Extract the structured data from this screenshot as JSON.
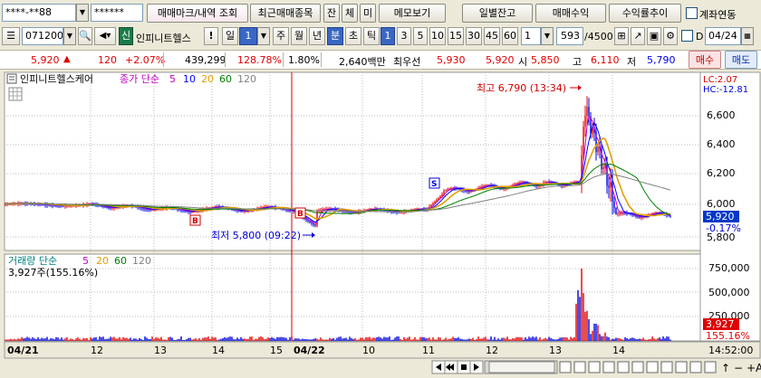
{
  "toolbar1": {
    "account": "****-**88",
    "password": "******",
    "mark_label": "매매마크/내역 조회",
    "recent_label": "최근매매종목",
    "jan": "잔",
    "che": "체",
    "mi": "미",
    "memo": "메모보기",
    "daily_balance": "일별잔고",
    "trade_profit": "매매수익",
    "yield_trend": "수익률추이",
    "account_link": "계좌연동"
  },
  "toolbar2": {
    "code": "071200",
    "sin": "신",
    "stock_name": "인피니트헬스",
    "alert": "!",
    "il": "일",
    "period_select": "1",
    "ju": "주",
    "wol": "월",
    "nyeon": "년",
    "bun": "분",
    "cho": "초",
    "tik": "틱",
    "intervals": [
      "1",
      "3",
      "5",
      "10",
      "15",
      "30",
      "45",
      "60"
    ],
    "count_select": "1",
    "count": "593",
    "max": "/4500",
    "d_label": "D",
    "date": "04/24"
  },
  "quote": {
    "price": "5,920",
    "arrow": "▲",
    "change": "120",
    "change_pct": "+2.07%",
    "volume": "439,299",
    "vol_ratio": "128.78%",
    "turnover": "1.80%",
    "amount": "2,640백만",
    "best_label": "최우선",
    "best_ask": "5,930",
    "best_bid": "5,920",
    "open_label": "시",
    "open": "5,850",
    "high_label": "고",
    "high": "6,110",
    "low_label": "저",
    "low": "5,790",
    "buy_btn": "매수",
    "sell_btn": "매도"
  },
  "price_panel": {
    "stock_name": "인피니트헬스케어",
    "ma_label": "종가 단순",
    "ma_periods": [
      "5",
      "10",
      "20",
      "60",
      "120"
    ],
    "lc": "LC:2.07",
    "hc": "HC:-12.81",
    "high_annot": "최고 6,790 (13:34)",
    "low_annot": "최저 5,800 (09:22)",
    "y_ticks": [
      "6,600",
      "6,400",
      "6,200",
      "6,000",
      "5,800"
    ],
    "current_price": "5,920",
    "current_pct": "-0.17%",
    "markers": [
      "B",
      "B",
      "S"
    ]
  },
  "volume_panel": {
    "title": "거래량 단순",
    "ma_periods": [
      "5",
      "20",
      "60",
      "120"
    ],
    "current": "3,927주(155.16%)",
    "y_ticks": [
      "750,000",
      "500,000",
      "250,000"
    ],
    "current_vol": "3,927",
    "current_pct": "155.16%"
  },
  "xaxis": {
    "labels": [
      "04/21",
      "12",
      "13",
      "14",
      "15",
      "04/22",
      "10",
      "11",
      "12",
      "13",
      "14"
    ],
    "time": "14:52:00"
  },
  "colors": {
    "up": "#e00000",
    "down": "#0000dd",
    "ma5": "#c000c0",
    "ma10": "#0000ff",
    "ma20": "#e0a000",
    "ma60": "#008000",
    "ma120": "#808080"
  }
}
